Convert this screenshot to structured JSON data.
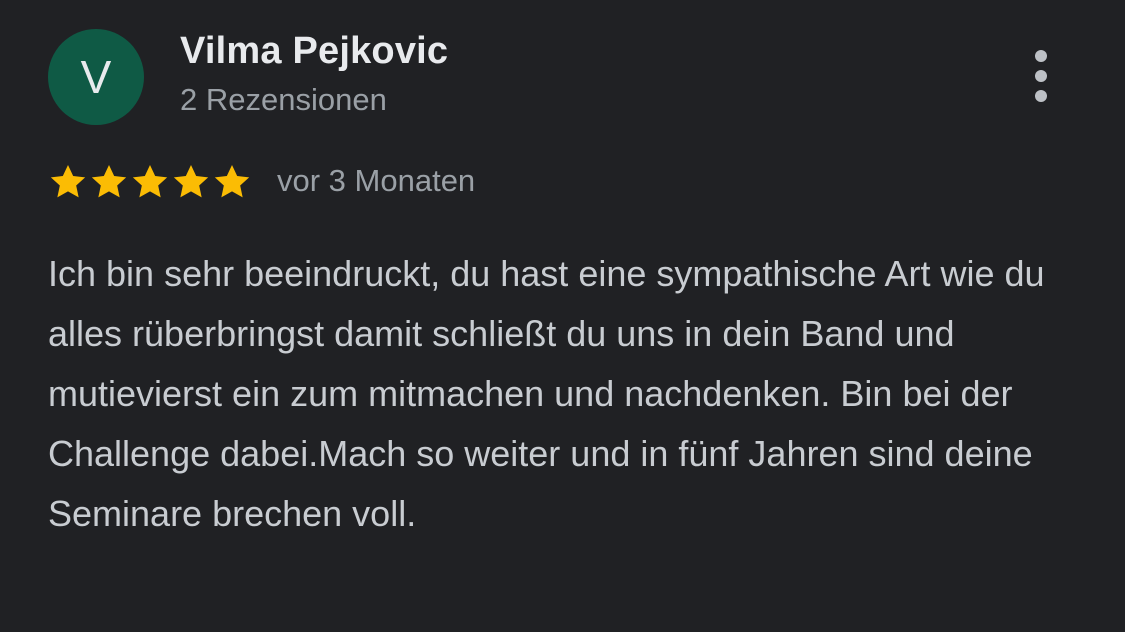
{
  "review": {
    "avatar_letter": "V",
    "author": "Vilma Pejkovic",
    "review_count": "2 Rezensionen",
    "rating": 5,
    "rating_max": 5,
    "date": "vor 3 Monaten",
    "text": "Ich bin sehr beeindruckt, du hast eine sympathische Art wie du alles rüberbringst damit schließt du uns in dein Band und mutievierst ein zum mitmachen und nachdenken. Bin bei der Challenge dabei.Mach so weiter und in fünf Jahren sind deine Seminare brechen voll.",
    "more_icon": "more-vert-icon",
    "star_icon": "star-icon"
  },
  "colors": {
    "background": "#202124",
    "avatar_bg": "#0f5a45",
    "star": "#fbbc04",
    "name": "#e8eaed",
    "secondary": "#9aa0a6",
    "body_text": "#c8ccd1"
  }
}
